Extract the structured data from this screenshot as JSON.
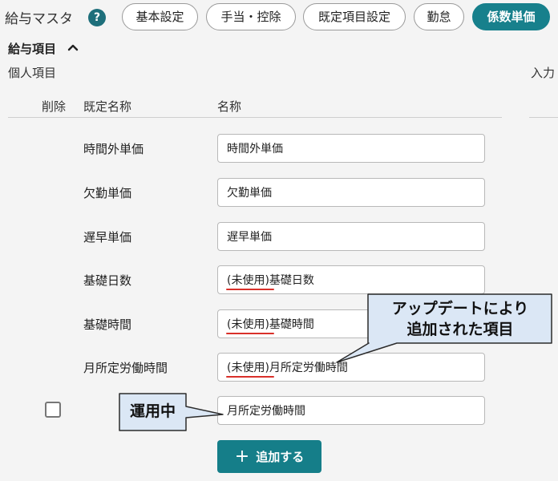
{
  "header": {
    "title": "給与マスタ",
    "help_icon": "?",
    "tabs": [
      {
        "label": "基本設定",
        "active": false
      },
      {
        "label": "手当・控除",
        "active": false
      },
      {
        "label": "既定項目設定",
        "active": false
      },
      {
        "label": "勤怠",
        "active": false
      },
      {
        "label": "係数単価",
        "active": true
      }
    ]
  },
  "section": {
    "title": "給与項目",
    "subtitle": "個人項目",
    "right_label": "入力"
  },
  "table": {
    "columns": [
      "削除",
      "既定名称",
      "名称"
    ],
    "rows": [
      {
        "default_name": "時間外単価",
        "name": "時間外単価"
      },
      {
        "default_name": "欠勤単価",
        "name": "欠勤単価"
      },
      {
        "default_name": "遅早単価",
        "name": "遅早単価"
      },
      {
        "default_name": "基礎日数",
        "name": "(未使用)基礎日数"
      },
      {
        "default_name": "基礎時間",
        "name": "(未使用)基礎時間"
      },
      {
        "default_name": "月所定労働時間",
        "name": "(未使用)月所定労働時間"
      },
      {
        "default_name": "",
        "name": "月所定労働時間"
      }
    ],
    "add_button": "追加する"
  },
  "annotations": {
    "update_note": [
      "アップデートにより",
      "追加された項目"
    ],
    "in_use_note": "運用中"
  },
  "colors": {
    "accent": "#17808c",
    "callout_fill": "#dbe7f5",
    "underline": "#d9302a"
  }
}
